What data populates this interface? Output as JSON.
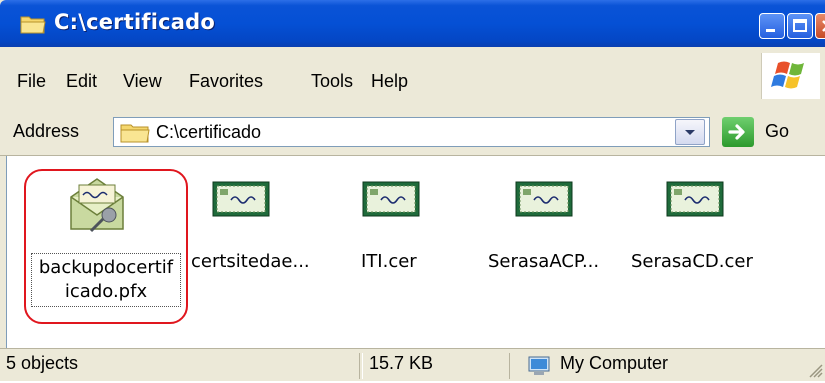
{
  "window": {
    "title": "C:\\certificado"
  },
  "menu": {
    "items": [
      "File",
      "Edit",
      "View",
      "Favorites",
      "Tools",
      "Help"
    ]
  },
  "address": {
    "label": "Address",
    "path": "C:\\certificado",
    "go_label": "Go"
  },
  "files": [
    {
      "name_line1": "backupdocertif",
      "name_line2": "icado.pfx",
      "type": "pfx",
      "selected": true
    },
    {
      "name": "certsitedae...",
      "type": "cer"
    },
    {
      "name": "ITI.cer",
      "type": "cer"
    },
    {
      "name": "SerasaACP...",
      "type": "cer"
    },
    {
      "name": "SerasaCD.cer",
      "type": "cer"
    }
  ],
  "status": {
    "objects": "5 objects",
    "size": "15.7 KB",
    "zone": "My Computer"
  },
  "colors": {
    "title_bar": "#0550d5",
    "highlight_ring": "#e0161e",
    "go_green": "#2d9a2d"
  }
}
